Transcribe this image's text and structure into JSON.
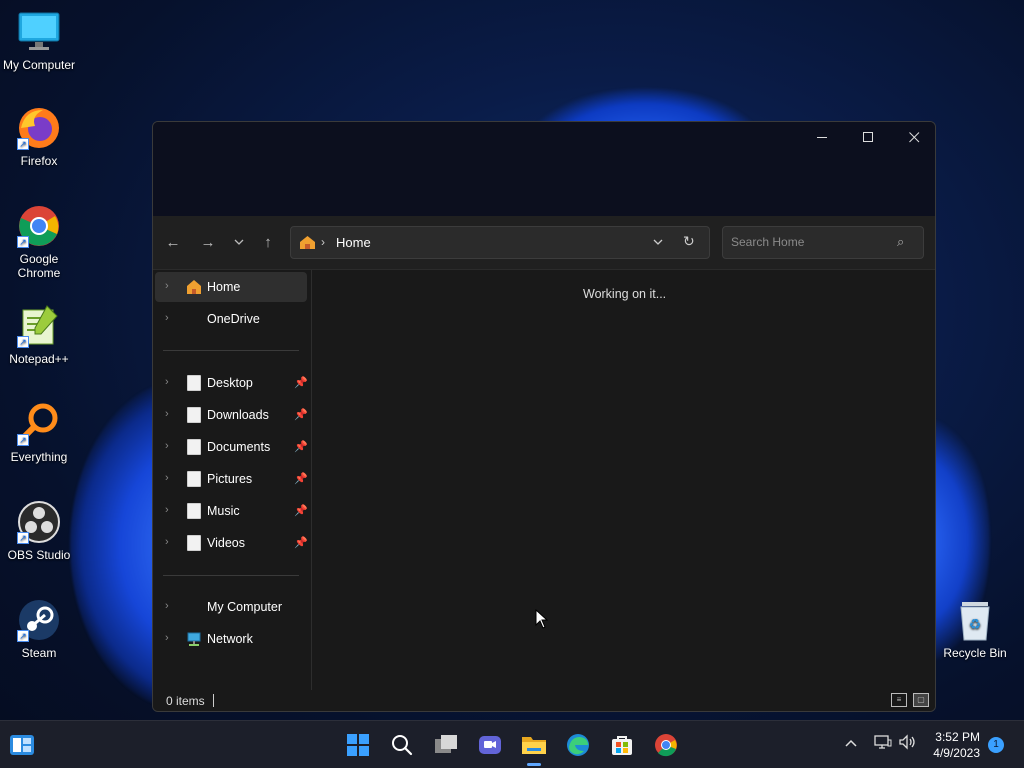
{
  "desktop": {
    "icons": [
      {
        "label": "My Computer",
        "icon": "monitor-icon"
      },
      {
        "label": "Firefox",
        "icon": "firefox-icon"
      },
      {
        "label": "Google Chrome",
        "icon": "chrome-icon"
      },
      {
        "label": "Notepad++",
        "icon": "notepadpp-icon"
      },
      {
        "label": "Everything",
        "icon": "everything-search-icon"
      },
      {
        "label": "OBS Studio",
        "icon": "obs-icon"
      },
      {
        "label": "Steam",
        "icon": "steam-icon"
      },
      {
        "label": "Recycle Bin",
        "icon": "recycle-bin-icon"
      }
    ]
  },
  "explorer": {
    "address": {
      "crumb": "Home"
    },
    "search": {
      "placeholder": "Search Home"
    },
    "sidebar": {
      "top": [
        {
          "label": "Home",
          "icon": "home-icon",
          "selected": true
        },
        {
          "label": "OneDrive",
          "icon": "onedrive-icon"
        }
      ],
      "quick_access": [
        {
          "label": "Desktop",
          "pinned": true
        },
        {
          "label": "Downloads",
          "pinned": true
        },
        {
          "label": "Documents",
          "pinned": true
        },
        {
          "label": "Pictures",
          "pinned": true
        },
        {
          "label": "Music",
          "pinned": true
        },
        {
          "label": "Videos",
          "pinned": true
        }
      ],
      "bottom": [
        {
          "label": "My Computer",
          "icon": "computer-icon"
        },
        {
          "label": "Network",
          "icon": "network-icon"
        }
      ]
    },
    "content": {
      "status_message": "Working on it..."
    },
    "statusbar": {
      "items": "0 items"
    }
  },
  "taskbar": {
    "clock": {
      "time": "3:52 PM",
      "date": "4/9/2023"
    },
    "notification_count": "1"
  },
  "colors": {
    "accent": "#60a8ff",
    "window_bg": "#191919",
    "titlebar_bg": "#0c0f1e"
  }
}
